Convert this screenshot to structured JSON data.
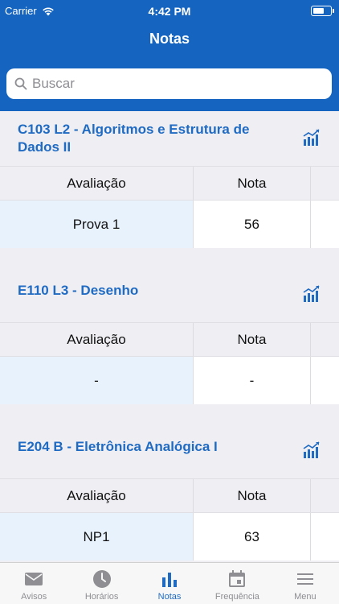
{
  "statusbar": {
    "carrier": "Carrier",
    "time": "4:42 PM"
  },
  "nav": {
    "title": "Notas"
  },
  "search": {
    "placeholder": "Buscar"
  },
  "table_headers": {
    "avaliacao": "Avaliação",
    "nota": "Nota"
  },
  "sections": [
    {
      "title": "C103 L2 - Algoritmos e Estrutura de Dados II",
      "rows": [
        {
          "avaliacao": "Prova 1",
          "nota": "56"
        }
      ]
    },
    {
      "title": "E110 L3 - Desenho",
      "rows": [
        {
          "avaliacao": "-",
          "nota": "-"
        }
      ]
    },
    {
      "title": "E204 B - Eletrônica Analógica I",
      "rows": [
        {
          "avaliacao": "NP1",
          "nota": "63"
        }
      ]
    }
  ],
  "tabbar": {
    "items": [
      {
        "label": "Avisos",
        "icon": "envelope-icon"
      },
      {
        "label": "Horários",
        "icon": "clock-icon"
      },
      {
        "label": "Notas",
        "icon": "bar-chart-icon",
        "active": true
      },
      {
        "label": "Frequência",
        "icon": "calendar-icon"
      },
      {
        "label": "Menu",
        "icon": "hamburger-icon"
      }
    ]
  },
  "colors": {
    "primary": "#1565c0",
    "accent": "#1f6bc3",
    "inactive": "#8e8e93"
  }
}
